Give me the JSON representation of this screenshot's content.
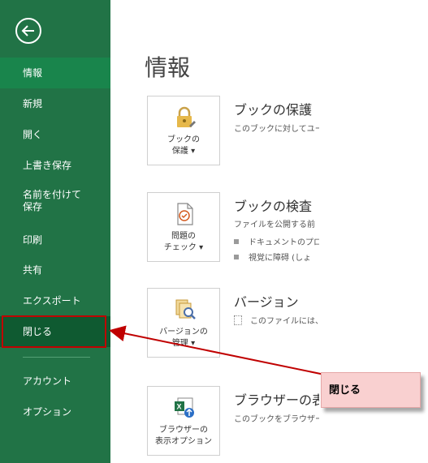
{
  "sidebar": {
    "items": [
      {
        "label": "情報"
      },
      {
        "label": "新規"
      },
      {
        "label": "開く"
      },
      {
        "label": "上書き保存"
      },
      {
        "label": "名前を付けて\n保存"
      },
      {
        "label": "印刷"
      },
      {
        "label": "共有"
      },
      {
        "label": "エクスポート"
      },
      {
        "label": "閉じる"
      },
      {
        "label": "アカウント"
      },
      {
        "label": "オプション"
      }
    ]
  },
  "main": {
    "title": "情報",
    "sections": [
      {
        "tile_label": "ブックの\n保護 ▾",
        "heading": "ブックの保護",
        "desc": "このブックに対してユーザ"
      },
      {
        "tile_label": "問題の\nチェック ▾",
        "heading": "ブックの検査",
        "desc": "ファイルを公開する前",
        "bullets": [
          "ドキュメントのプロ",
          "視覚に障碍 (しょ"
        ]
      },
      {
        "tile_label": "バージョンの\n管理 ▾",
        "heading": "バージョン",
        "desc": "このファイルには、"
      },
      {
        "tile_label": "ブラウザーの\n表示オプション",
        "heading": "ブラウザーの表",
        "desc": "このブックをブラウザー"
      }
    ]
  },
  "callout": {
    "text": "閉じる"
  },
  "colors": {
    "sidebar": "#217346",
    "active": "#19854c",
    "annotation_red": "#c00000",
    "callout_bg": "#f9d0d0"
  }
}
